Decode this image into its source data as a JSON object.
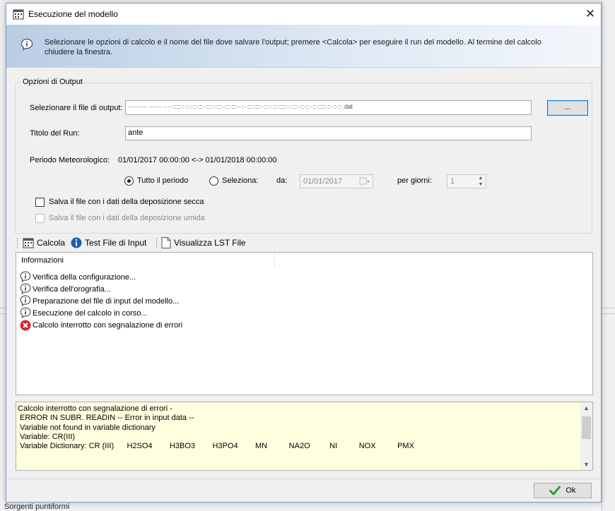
{
  "background": {
    "status_text": "Sorgenti puntiformi"
  },
  "dialog": {
    "title": "Esecuzione del modello",
    "close_label": "✕",
    "banner_text": "Selezionare le opzioni di calcolo e il nome del file dove salvare l'output; premere <Calcola> per eseguire il run del modello. Al termine del calcolo chiudere la finestra."
  },
  "output_options": {
    "legend": "Opzioni di Output",
    "file_label": "Selezionare il file di output:",
    "file_value": "··········  ·······  ·····:::::·:·:·:·::·:::··:::·:·:::··:::·:::···:··:::·::::··::·:·:::·:::::·:·:::··::·::··::·:::::·::··:·::·.dat",
    "browse_label": "...",
    "run_title_label": "Titolo del Run:",
    "run_title_value": "ante",
    "met_period_label": "Periodo Meteorologico:",
    "met_period_value": "01/01/2017 00:00:00 <-> 01/01/2018 00:00:00",
    "radio_all": "Tutto il periodo",
    "radio_select": "Seleziona:",
    "from_label": "da:",
    "from_value": "01/01/2017",
    "days_label": "per giorni:",
    "days_value": "1",
    "check_dry": "Salva il file con i dati della deposizione secca",
    "check_wet": "Salva il file con i dati della deposizione umida"
  },
  "toolbar": {
    "calc_label": "Calcola",
    "test_label": "Test File di Input",
    "lst_label": "Visualizza LST File"
  },
  "info": {
    "header": "Informazioni",
    "items": [
      {
        "text": "Verifica della configurazione...",
        "icon": "info-icon"
      },
      {
        "text": "Verifica dell'orografia...",
        "icon": "info-icon"
      },
      {
        "text": "Preparazione del file di input del modello...",
        "icon": "info-icon"
      },
      {
        "text": "Esecuzione del calcolo in corso...",
        "icon": "info-icon"
      },
      {
        "text": "Calcolo interrotto con segnalazione di errori",
        "icon": "error-icon"
      }
    ]
  },
  "error_log": {
    "lines": [
      "Calcolo interrotto con segnalazione di errori -",
      " ERROR IN SUBR. READIN -- Error in input data --",
      " Variable not found in variable dictionary",
      " Variable: CR(III)",
      " Variable Dictionary: CR (III)      H2SO4        H3BO3        H3PO4        MN          NA2O         NI          NOX          PMX"
    ]
  },
  "footer": {
    "ok_label": "Ok"
  },
  "colors": {
    "accent": "#0078d7",
    "banner_start": "#b9cde4",
    "error_bg": "#ffffe0",
    "error_icon": "#d9232b",
    "info_icon": "#1a5fb4",
    "ok_check": "#2f9e2f"
  }
}
